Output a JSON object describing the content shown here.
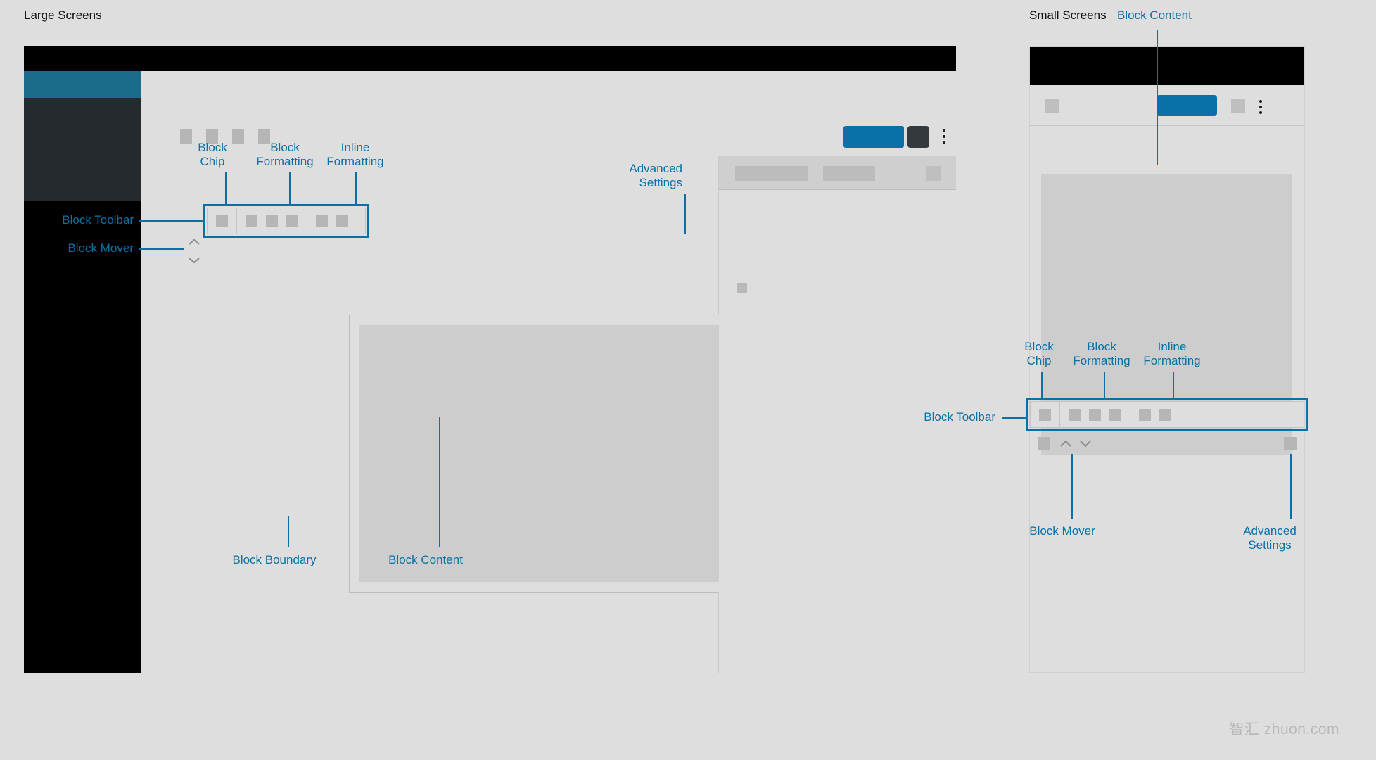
{
  "sections": {
    "large": {
      "title": "Large Screens"
    },
    "small": {
      "title": "Small Screens"
    }
  },
  "annotations": {
    "block_chip": "Block\nChip",
    "block_formatting": "Block\nFormatting",
    "inline_formatting": "Inline\nFormatting",
    "advanced_settings": "Advanced\nSettings",
    "block_toolbar": "Block Toolbar",
    "block_mover": "Block Mover",
    "block_boundary": "Block Boundary",
    "block_content": "Block Content"
  },
  "colors": {
    "accent_blue": "#0a71a8",
    "annotation_blue": "#0a71a8",
    "sidebar_accent": "#1b6b8a",
    "sidebar_panel": "#242a2e",
    "canvas_bg": "#dedede",
    "placeholder_grey": "#b6b6b6",
    "content_grey": "#cdcdcd",
    "dark_button": "#34393d"
  },
  "large_window": {
    "header": {
      "placeholder_squares": 4,
      "primary_button": "",
      "dark_button": "",
      "overflow_menu": "kebab-menu-icon"
    },
    "right_panel": {
      "chips": 2,
      "square": ""
    },
    "toolbar": {
      "groups": [
        {
          "name": "block-chip",
          "buttons": 1
        },
        {
          "name": "block-formatting",
          "buttons": 3
        },
        {
          "name": "inline-formatting",
          "buttons": 2
        }
      ]
    },
    "mover": {
      "up": "chevron-up-icon",
      "down": "chevron-down-icon"
    }
  },
  "small_window": {
    "header": {
      "left_square": "",
      "primary_button": "",
      "right_square": "",
      "overflow_menu": "kebab-menu-icon"
    },
    "toolbar": {
      "groups": [
        {
          "name": "block-chip",
          "buttons": 1
        },
        {
          "name": "block-formatting",
          "buttons": 3
        },
        {
          "name": "inline-formatting",
          "buttons": 2
        },
        {
          "name": "spacer",
          "buttons": 0
        }
      ]
    },
    "mover": {
      "up": "chevron-up-icon",
      "down": "chevron-down-icon"
    }
  },
  "watermark": {
    "text": "智汇 zhuon.com"
  }
}
